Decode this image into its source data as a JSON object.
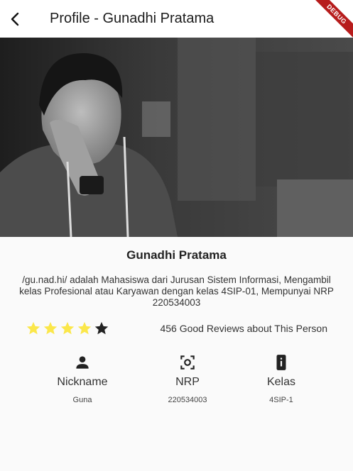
{
  "appbar": {
    "title": "Profile - Gunadhi Pratama",
    "back_icon": "arrow-back-icon"
  },
  "debug_banner": "DEBUG",
  "profile": {
    "name": "Gunadhi Pratama",
    "description": "/gu.nad.hi/ adalah Mahasiswa dari Jurusan Sistem Informasi, Mengambil kelas Profesional atau Karyawan dengan kelas 4SIP-01, Mempunyai NRP 220534003"
  },
  "rating": {
    "stars_filled": 4,
    "stars_total": 5,
    "filled_color": "#fbe74a",
    "empty_color": "#222222",
    "reviews_text": "456 Good Reviews about This Person"
  },
  "info": [
    {
      "icon": "person-icon",
      "label": "Nickname",
      "value": "Guna"
    },
    {
      "icon": "center-focus-icon",
      "label": "NRP",
      "value": "220534003"
    },
    {
      "icon": "phone-info-icon",
      "label": "Kelas",
      "value": "4SIP-1"
    }
  ]
}
